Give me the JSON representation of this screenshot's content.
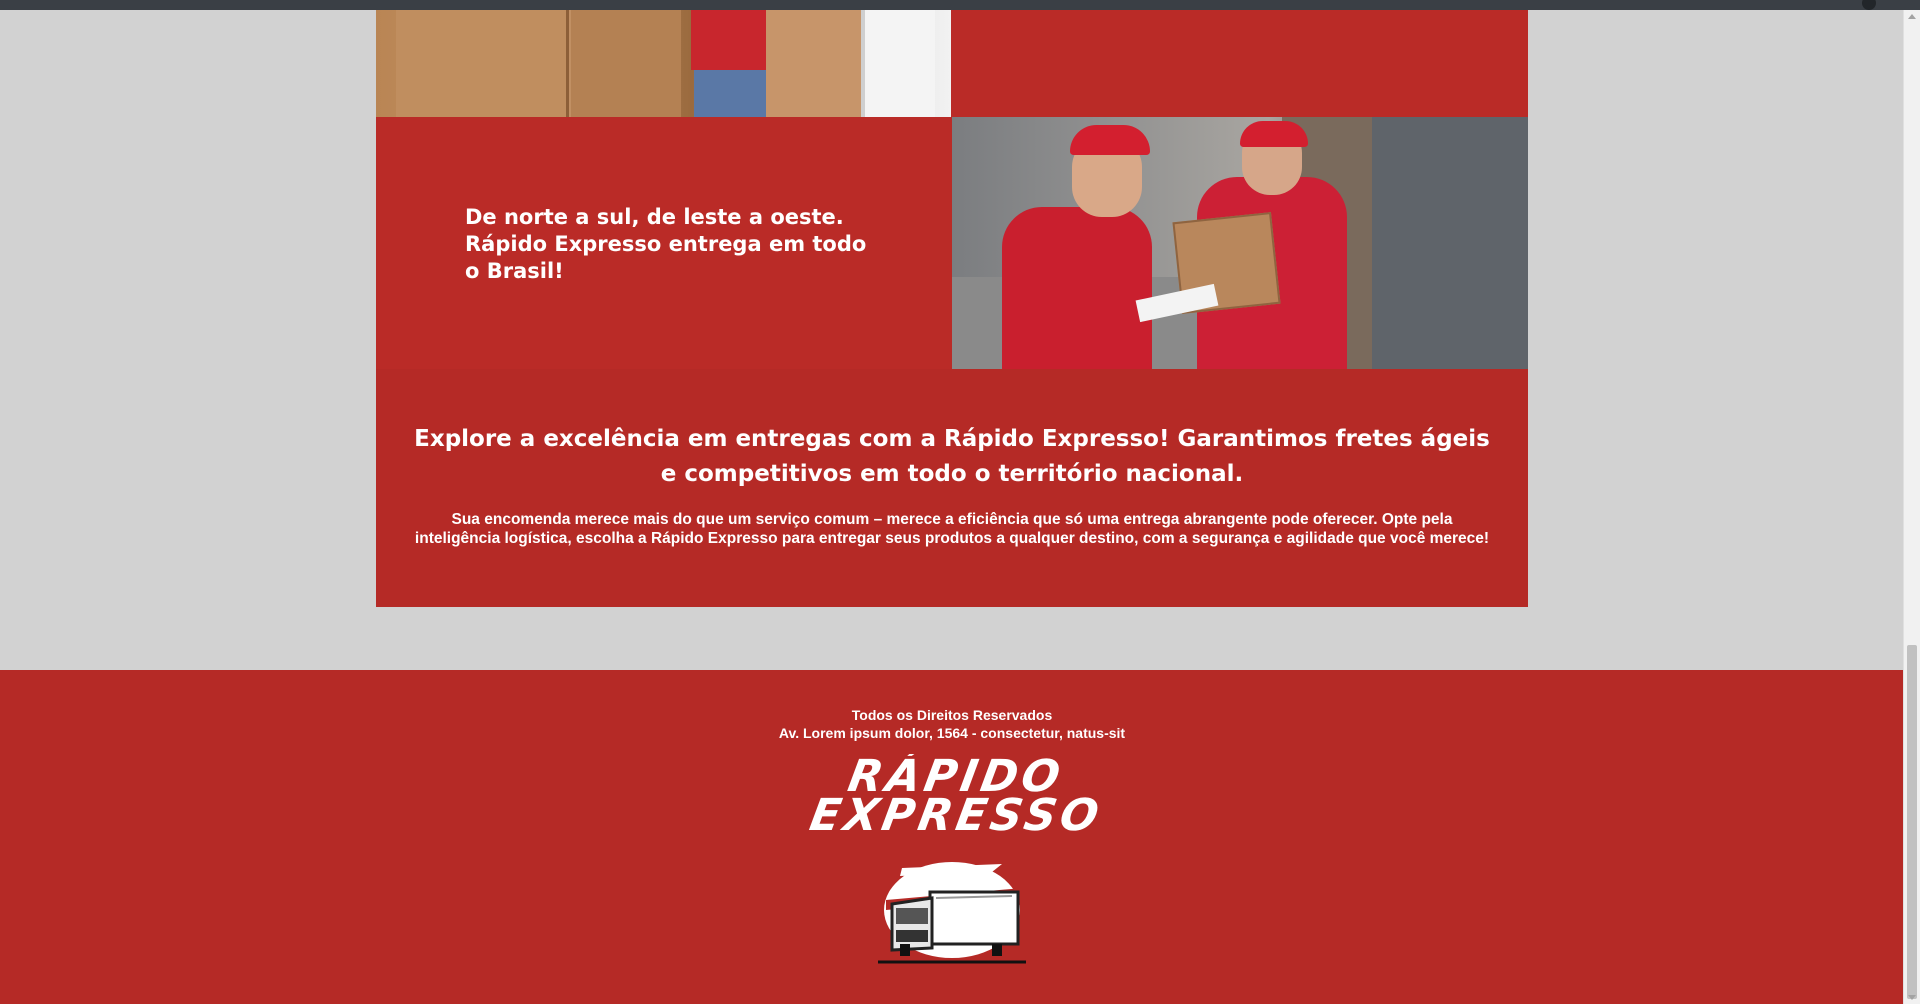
{
  "hero": {
    "tagline": "De norte a sul, de leste a oeste. Rápido Expresso entrega em todo o Brasil!"
  },
  "promo": {
    "headline": "Explore a excelência em entregas com a Rápido Expresso! Garantimos fretes ágeis e competitivos em todo o território nacional.",
    "body": "Sua encomenda merece mais do que um serviço comum – merece a eficiência que só uma entrega abrangente pode oferecer. Opte pela inteligência logística, escolha a Rápido Expresso para entregar seus produtos a qualquer destino, com a segurança e agilidade que você merece!"
  },
  "footer": {
    "rights": "Todos os Direitos Reservados",
    "address": "Av. Lorem ipsum dolor, 1564 - consectetur, natus-sit",
    "logo_line1": "RÁPIDO",
    "logo_line2": "EXPRESSO"
  },
  "colors": {
    "brand_red": "#b52a26",
    "background": "#d2d2d2",
    "text": "#ffffff"
  },
  "icons": {
    "truck": "truck-logo-icon"
  }
}
